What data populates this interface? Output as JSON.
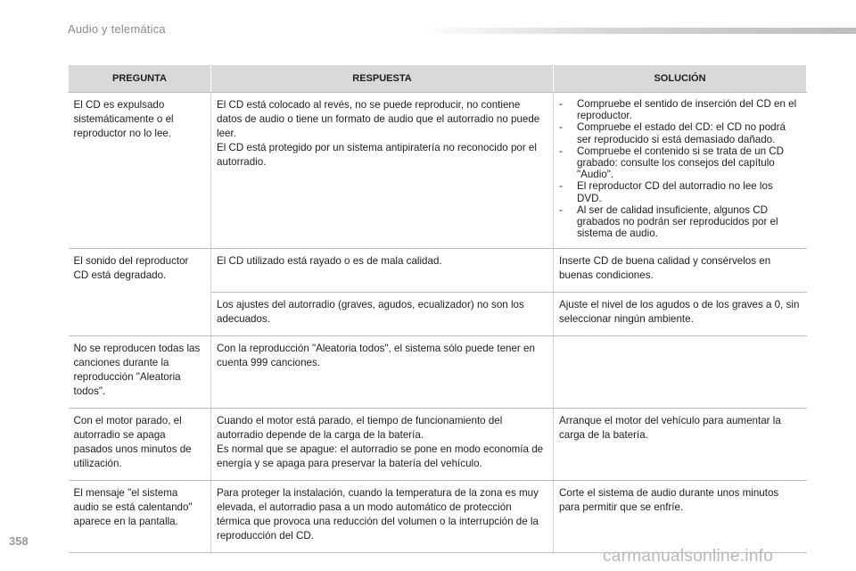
{
  "header": {
    "title": "Audio y telemática"
  },
  "footer": {
    "page_number": "358",
    "watermark": "carmanualsonline.info"
  },
  "table": {
    "headers": [
      "PREGUNTA",
      "RESPUESTA",
      "SOLUCIÓN"
    ],
    "rows": [
      {
        "question": "El CD es expulsado sistemáticamente o el reproductor no lo lee.",
        "answer": [
          "El CD está colocado al revés, no se puede reproducir, no contiene datos de audio o tiene un formato de audio que el autorradio no puede leer.",
          "El CD está protegido por un sistema antipiratería no reconocido por el autorradio."
        ],
        "solution_list": [
          "Compruebe el sentido de inserción del CD en el reproductor.",
          "Compruebe el estado del CD: el CD no podrá ser reproducido si está demasiado dañado.",
          "Compruebe el contenido si se trata de un CD grabado: consulte los consejos del capítulo \"Audio\".",
          "El reproductor CD del autorradio no lee los DVD.",
          "Al ser de calidad insuficiente, algunos CD grabados no podrán ser reproducidos por el sistema de audio."
        ]
      },
      {
        "question": "El sonido del reproductor CD está degradado.",
        "answer": "El CD utilizado está rayado o es de mala calidad.",
        "solution": "Inserte CD de buena calidad y consérvelos en buenas condiciones."
      },
      {
        "answer": "Los ajustes del autorradio (graves, agudos, ecualizador) no son los adecuados.",
        "solution": "Ajuste el nivel de los agudos o de los graves a 0, sin seleccionar ningún ambiente."
      },
      {
        "question": "No se reproducen todas las canciones durante la reproducción \"Aleatoria todos\".",
        "answer": "Con la reproducción \"Aleatoria todos\", el sistema sólo puede tener en cuenta 999 canciones.",
        "solution": ""
      },
      {
        "question": "Con el motor parado, el autorradio se apaga pasados unos minutos de utilización.",
        "answer": [
          "Cuando el motor está parado, el tiempo de funcionamiento del autorradio depende de la carga de la batería.",
          "Es normal que se apague: el autorradio se pone en modo economía de energía y se apaga para preservar la batería del vehículo."
        ],
        "solution": "Arranque el motor del vehículo para aumentar la carga de la batería."
      },
      {
        "question": "El mensaje \"el sistema audio se está calentando\" aparece en la pantalla.",
        "answer": "Para proteger la instalación, cuando la temperatura de la zona es muy elevada, el autorradio pasa a un modo automático de protección térmica que provoca una reducción del volumen o la interrupción de la reproducción del CD.",
        "solution": "Corte el sistema de audio durante unos minutos para permitir que se enfríe."
      }
    ]
  }
}
